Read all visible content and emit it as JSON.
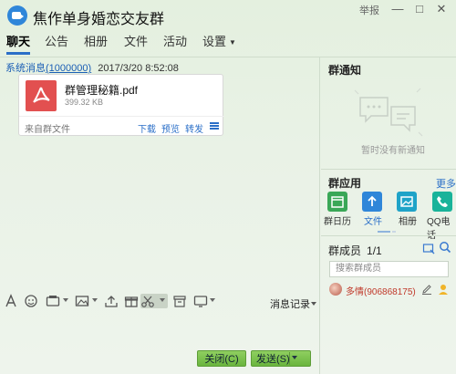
{
  "window": {
    "title": "焦作单身婚恋交友群",
    "report": "举报",
    "minimize": "—",
    "maximize": "□",
    "close": "✕"
  },
  "tabs": [
    {
      "label": "聊天",
      "active": true
    },
    {
      "label": "公告"
    },
    {
      "label": "相册"
    },
    {
      "label": "文件"
    },
    {
      "label": "活动"
    },
    {
      "label": "设置"
    }
  ],
  "message": {
    "sender": "系统消息",
    "sender_id": "(1000000)",
    "time": "2017/3/20 8:52:08",
    "file": {
      "name": "群管理秘籍.pdf",
      "size": "399.32 KB",
      "source": "来自群文件",
      "actions": [
        "下载",
        "预览",
        "转发"
      ],
      "icon": "pdf-file-icon",
      "color": "#e25050"
    }
  },
  "toolbar": {
    "icons": [
      "font-icon",
      "emoji-icon",
      "gif-icon",
      "image-icon",
      "upload-icon",
      "gift-icon",
      "scissors-icon",
      "folder-icon",
      "screen-share-icon"
    ],
    "history_label": "消息记录"
  },
  "buttons": {
    "close": "关闭(C)",
    "send": "发送(S)"
  },
  "right_panel": {
    "notice_title": "群通知",
    "notice_empty": "暂时没有新通知",
    "apps_title": "群应用",
    "more": "更多",
    "apps": [
      {
        "label": "群日历",
        "icon": "calendar-icon",
        "color": "#3aa757"
      },
      {
        "label": "文件",
        "icon": "file-upload-icon",
        "color": "#2f86d9",
        "active": true
      },
      {
        "label": "相册",
        "icon": "album-icon",
        "color": "#1fa3c8"
      },
      {
        "label": "QQ电话",
        "icon": "phone-icon",
        "color": "#19b39a"
      }
    ],
    "members_title": "群成员",
    "members_count": "1/1",
    "search_placeholder": "搜索群成员",
    "members": [
      {
        "name": "多情(906868175)"
      }
    ]
  },
  "colors": {
    "accent": "#2b6fc8",
    "send_button": "#6ab53e"
  }
}
